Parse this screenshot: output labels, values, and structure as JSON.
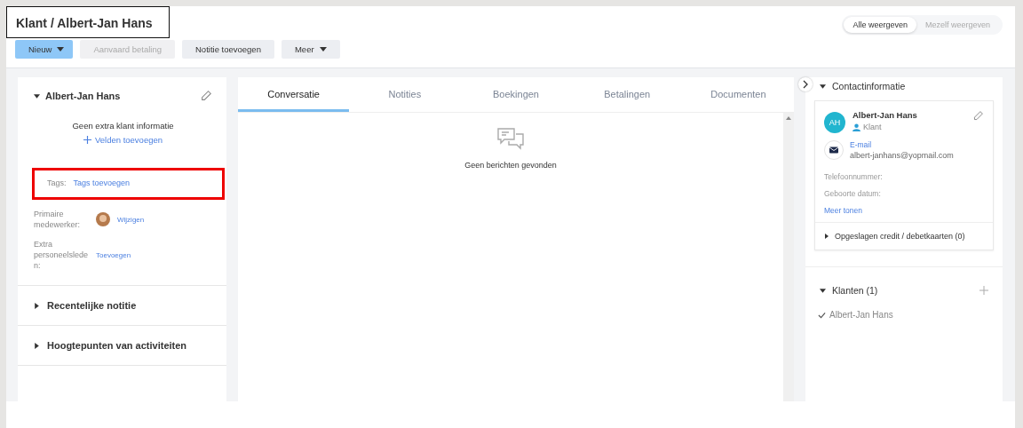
{
  "header": {
    "title": "Klant / Albert-Jan Hans",
    "highlighted": true
  },
  "actions": [
    {
      "label": "Nieuw",
      "kind": "primary",
      "dropdown": true,
      "disabled": false
    },
    {
      "label": "Aanvaard betaling",
      "kind": "secondary",
      "dropdown": false,
      "disabled": true
    },
    {
      "label": "Notitie toevoegen",
      "kind": "secondary",
      "dropdown": false,
      "disabled": false
    },
    {
      "label": "Meer",
      "kind": "secondary",
      "dropdown": true,
      "disabled": false
    }
  ],
  "view_toggle": [
    {
      "label": "Alle weergeven",
      "selected": true
    },
    {
      "label": "Mezelf weergeven",
      "selected": false
    }
  ],
  "client_card": {
    "name": "Albert-Jan Hans",
    "expanded": true,
    "empty_text": "Geen extra klant informatie",
    "add_fields": "Velden toevoegen",
    "tags": {
      "label": "Tags:",
      "link": "Tags toevoegen",
      "highlighted": true
    },
    "staff": [
      {
        "label": "Primaire medewerker:",
        "link": "Wijzigen",
        "avatar": true
      },
      {
        "label": "Extra personeelsleden:",
        "link": "Toevoegen",
        "avatar": false
      }
    ]
  },
  "sections": [
    {
      "label": "Recentelijke notitie",
      "expanded": false
    },
    {
      "label": "Hoogtepunten van activiteiten",
      "expanded": false
    }
  ],
  "tabs": [
    {
      "label": "Conversatie",
      "selected": true
    },
    {
      "label": "Notities",
      "selected": false
    },
    {
      "label": "Boekingen",
      "selected": false
    },
    {
      "label": "Betalingen",
      "selected": false
    },
    {
      "label": "Documenten",
      "selected": false
    }
  ],
  "empty_message": "Geen berichten gevonden",
  "contact": {
    "title": "Contactinformatie",
    "expanded": true,
    "initials": "AH",
    "name": "Albert-Jan Hans",
    "role": "Klant",
    "email_label": "E-mail",
    "email": "albert-janhans@yopmail.com",
    "fields": [
      "Telefoonnummer:",
      "Geboorte datum:"
    ],
    "more": "Meer tonen",
    "cards": {
      "label": "Opgeslagen credit / debetkaarten (0)",
      "expanded": false
    }
  },
  "clients": {
    "title": "Klanten (1)",
    "expanded": true,
    "items": [
      {
        "name": "Albert-Jan Hans",
        "checked": true
      }
    ]
  }
}
